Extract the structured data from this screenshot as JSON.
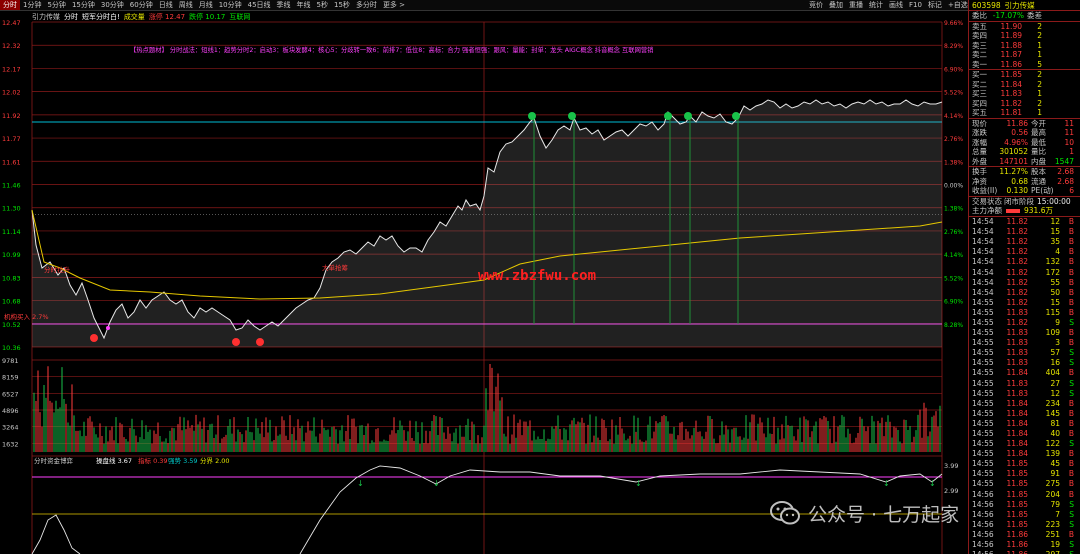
{
  "toolbar": {
    "tabs": [
      "分时",
      "1分钟",
      "5分钟",
      "15分钟",
      "30分钟",
      "60分钟",
      "日线",
      "周线",
      "月线",
      "10分钟",
      "45日线",
      "季线",
      "年线",
      "5秒",
      "15秒",
      "多分时",
      "更多 >"
    ],
    "right_tools": [
      "竞价",
      "叠加",
      "重播",
      "统计",
      "画线",
      "F10",
      "标记",
      "+自选",
      "返回"
    ]
  },
  "chart_header": {
    "stock": "引力传媒",
    "mode": "分时",
    "subtitle": "短军分时白!",
    "tag1": "成交量",
    "tag2": "涨停 12.47",
    "tag3": "跌停 10.17",
    "tag4": "互联网"
  },
  "banner": "【热点题材】 分时战法：短线1：趋势分时2：启动3：板块发酵4：核心5：分歧转一致6：前排7：低位8：高标：合力 强者恒强：跟风：量能：封单：龙头 AIGC概念 抖音概念 互联网营销",
  "y_labels": [
    "12.47",
    "12.32",
    "12.17",
    "12.02",
    "11.92",
    "11.77",
    "11.61",
    "11.46",
    "11.30",
    "11.14",
    "10.99",
    "10.83",
    "10.68",
    "10.52",
    "10.36",
    "9781",
    "8159",
    "6527",
    "4896",
    "3264",
    "1632"
  ],
  "pct_labels": [
    "9.66%",
    "8.29%",
    "6.90%",
    "5.52%",
    "4.14%",
    "2.76%",
    "1.38%",
    "0.00%",
    "1.38%",
    "2.76%",
    "4.14%",
    "5.52%",
    "6.90%",
    "8.28%"
  ],
  "annotations": {
    "low_buy": "机构买入 2.7%",
    "breakout": "大单抢筹",
    "up_label": "分时拉升"
  },
  "indicator": {
    "name": "分时资金博弈",
    "label1": "操盘线",
    "v1": "3.67",
    "label2": "指标",
    "v2": "0.39",
    "label3": "强势",
    "v3": "3.59",
    "label4": "分界",
    "v4": "2.00",
    "right_vals": [
      "3.99",
      "2.99"
    ]
  },
  "watermarks": {
    "site": "www.zbzfwu.com",
    "account": "公众号 · 七万起家"
  },
  "quote": {
    "code": "603598",
    "name": "引力传媒",
    "webi_label": "委比",
    "webi": "-17.07%",
    "weicha_label": "委差",
    "sells": [
      {
        "label": "卖五",
        "price": "11.90",
        "vol": "2"
      },
      {
        "label": "卖四",
        "price": "11.89",
        "vol": "2"
      },
      {
        "label": "卖三",
        "price": "11.88",
        "vol": "1"
      },
      {
        "label": "卖二",
        "price": "11.87",
        "vol": "1"
      },
      {
        "label": "卖一",
        "price": "11.86",
        "vol": "5"
      }
    ],
    "buys": [
      {
        "label": "买一",
        "price": "11.85",
        "vol": "2"
      },
      {
        "label": "买二",
        "price": "11.84",
        "vol": "2"
      },
      {
        "label": "买三",
        "price": "11.83",
        "vol": "1"
      },
      {
        "label": "买四",
        "price": "11.82",
        "vol": "2"
      },
      {
        "label": "买五",
        "price": "11.81",
        "vol": "1"
      }
    ],
    "stats": [
      {
        "k1": "现价",
        "v1": "11.86",
        "k2": "今开",
        "v2": "11"
      },
      {
        "k1": "涨跌",
        "v1": "0.56",
        "k2": "最高",
        "v2": "11"
      },
      {
        "k1": "涨幅",
        "v1": "4.96%",
        "k2": "最低",
        "v2": "10"
      },
      {
        "k1": "总量",
        "v1": "301052",
        "k2": "量比",
        "v2": "1"
      },
      {
        "k1": "外盘",
        "v1": "147101",
        "k2": "内盘",
        "v2": "1547"
      }
    ],
    "stats2": [
      {
        "k1": "换手",
        "v1": "11.27%",
        "k2": "股本",
        "v2": "2.68"
      },
      {
        "k1": "净资",
        "v1": "0.68",
        "k2": "流通",
        "v2": "2.68"
      },
      {
        "k1": "收益(II)",
        "v1": "0.130",
        "k2": "PE(动)",
        "v2": "6"
      }
    ],
    "trade_state_label": "交易状态",
    "trade_state": "闭市阶段",
    "trade_time": "15:00:00",
    "main_flow_label": "主力净额",
    "main_flow": "931.6万"
  },
  "trades": [
    {
      "t": "14:54",
      "p": "11.82",
      "v": "12",
      "d": "B"
    },
    {
      "t": "14:54",
      "p": "11.82",
      "v": "15",
      "d": "B"
    },
    {
      "t": "14:54",
      "p": "11.82",
      "v": "35",
      "d": "B"
    },
    {
      "t": "14:54",
      "p": "11.82",
      "v": "4",
      "d": "B"
    },
    {
      "t": "14:54",
      "p": "11.82",
      "v": "132",
      "d": "B"
    },
    {
      "t": "14:54",
      "p": "11.82",
      "v": "172",
      "d": "B"
    },
    {
      "t": "14:54",
      "p": "11.82",
      "v": "55",
      "d": "B"
    },
    {
      "t": "14:54",
      "p": "11.82",
      "v": "50",
      "d": "B"
    },
    {
      "t": "14:55",
      "p": "11.82",
      "v": "15",
      "d": "B"
    },
    {
      "t": "14:55",
      "p": "11.83",
      "v": "115",
      "d": "B"
    },
    {
      "t": "14:55",
      "p": "11.82",
      "v": "9",
      "d": "S"
    },
    {
      "t": "14:55",
      "p": "11.83",
      "v": "109",
      "d": "B"
    },
    {
      "t": "14:55",
      "p": "11.83",
      "v": "3",
      "d": "B"
    },
    {
      "t": "14:55",
      "p": "11.83",
      "v": "57",
      "d": "S"
    },
    {
      "t": "14:55",
      "p": "11.83",
      "v": "16",
      "d": "S"
    },
    {
      "t": "14:55",
      "p": "11.84",
      "v": "404",
      "d": "B"
    },
    {
      "t": "14:55",
      "p": "11.83",
      "v": "27",
      "d": "S"
    },
    {
      "t": "14:55",
      "p": "11.83",
      "v": "12",
      "d": "S"
    },
    {
      "t": "14:55",
      "p": "11.84",
      "v": "234",
      "d": "B"
    },
    {
      "t": "14:55",
      "p": "11.84",
      "v": "145",
      "d": "B"
    },
    {
      "t": "14:55",
      "p": "11.84",
      "v": "81",
      "d": "B"
    },
    {
      "t": "14:55",
      "p": "11.84",
      "v": "40",
      "d": "B"
    },
    {
      "t": "14:55",
      "p": "11.84",
      "v": "122",
      "d": "S"
    },
    {
      "t": "14:55",
      "p": "11.84",
      "v": "139",
      "d": "B"
    },
    {
      "t": "14:55",
      "p": "11.85",
      "v": "45",
      "d": "B"
    },
    {
      "t": "14:55",
      "p": "11.85",
      "v": "91",
      "d": "B"
    },
    {
      "t": "14:55",
      "p": "11.85",
      "v": "275",
      "d": "B"
    },
    {
      "t": "14:56",
      "p": "11.85",
      "v": "204",
      "d": "B"
    },
    {
      "t": "14:56",
      "p": "11.85",
      "v": "79",
      "d": "S"
    },
    {
      "t": "14:56",
      "p": "11.85",
      "v": "7",
      "d": "S"
    },
    {
      "t": "14:56",
      "p": "11.85",
      "v": "223",
      "d": "S"
    },
    {
      "t": "14:56",
      "p": "11.86",
      "v": "251",
      "d": "B"
    },
    {
      "t": "14:56",
      "p": "11.86",
      "v": "19",
      "d": "S"
    },
    {
      "t": "14:56",
      "p": "11.86",
      "v": "297",
      "d": "S"
    }
  ],
  "colors": {
    "up": "#ff3b3b",
    "down": "#00e600",
    "grid": "#8b1a1a",
    "avg": "#e6c800",
    "hline": "#00bcd4",
    "mag": "#ff40ff"
  }
}
